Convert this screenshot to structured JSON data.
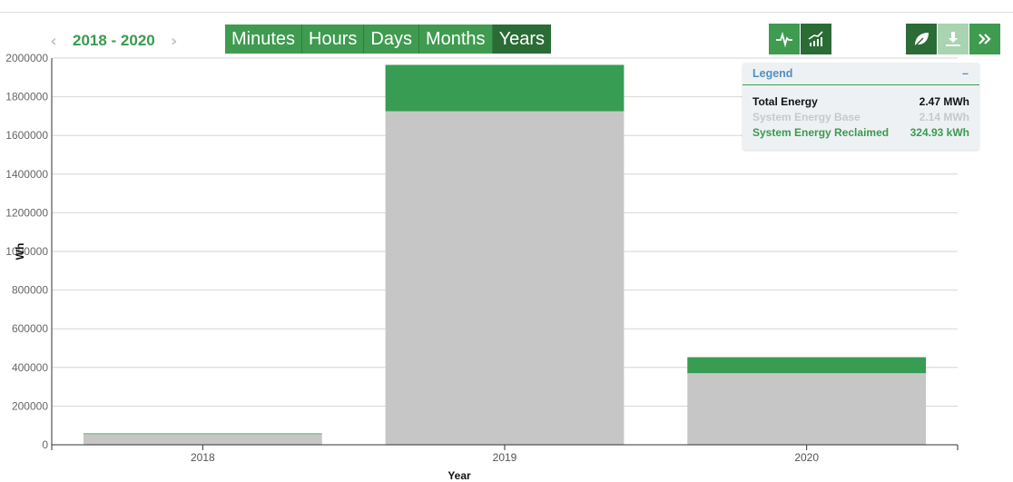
{
  "date_nav": {
    "range_label": "2018 - 2020"
  },
  "range_buttons": [
    {
      "label": "Minutes",
      "active": false
    },
    {
      "label": "Hours",
      "active": false
    },
    {
      "label": "Days",
      "active": false
    },
    {
      "label": "Months",
      "active": false
    },
    {
      "label": "Years",
      "active": true
    }
  ],
  "legend": {
    "title": "Legend",
    "collapse_symbol": "–",
    "rows": [
      {
        "label": "Total Energy",
        "value": "2.47 MWh"
      },
      {
        "label": "System Energy Base",
        "value": "2.14 MWh"
      },
      {
        "label": "System Energy Reclaimed",
        "value": "324.93 kWh"
      }
    ]
  },
  "colors": {
    "accent_green": "#3e9b4f",
    "dark_green": "#2b6b36",
    "base_gray": "#c6c6c6",
    "reclaimed_green": "#389d52",
    "link_blue": "#4f8fc6"
  },
  "icons": [
    "chevron-left-icon",
    "chevron-right-icon",
    "pulse-icon",
    "bar-trend-icon",
    "leaf-icon",
    "download-icon",
    "double-chevron-right-icon"
  ],
  "chart_data": {
    "type": "bar",
    "stacked": true,
    "categories": [
      "2018",
      "2019",
      "2020"
    ],
    "series": [
      {
        "name": "System Energy Base",
        "values": [
          55000,
          1725000,
          370000
        ],
        "color": "#c6c6c6"
      },
      {
        "name": "System Energy Reclaimed",
        "values": [
          4000,
          240000,
          83000
        ],
        "color": "#389d52"
      }
    ],
    "xlabel": "Year",
    "ylabel": "Wh",
    "ylim": [
      0,
      2000000
    ],
    "yticks": [
      "0",
      "200000",
      "400000",
      "600000",
      "800000",
      "1000000",
      "1200000",
      "1400000",
      "1600000",
      "1800000",
      "2000000"
    ],
    "grid": true,
    "legend_position": "top-right"
  }
}
